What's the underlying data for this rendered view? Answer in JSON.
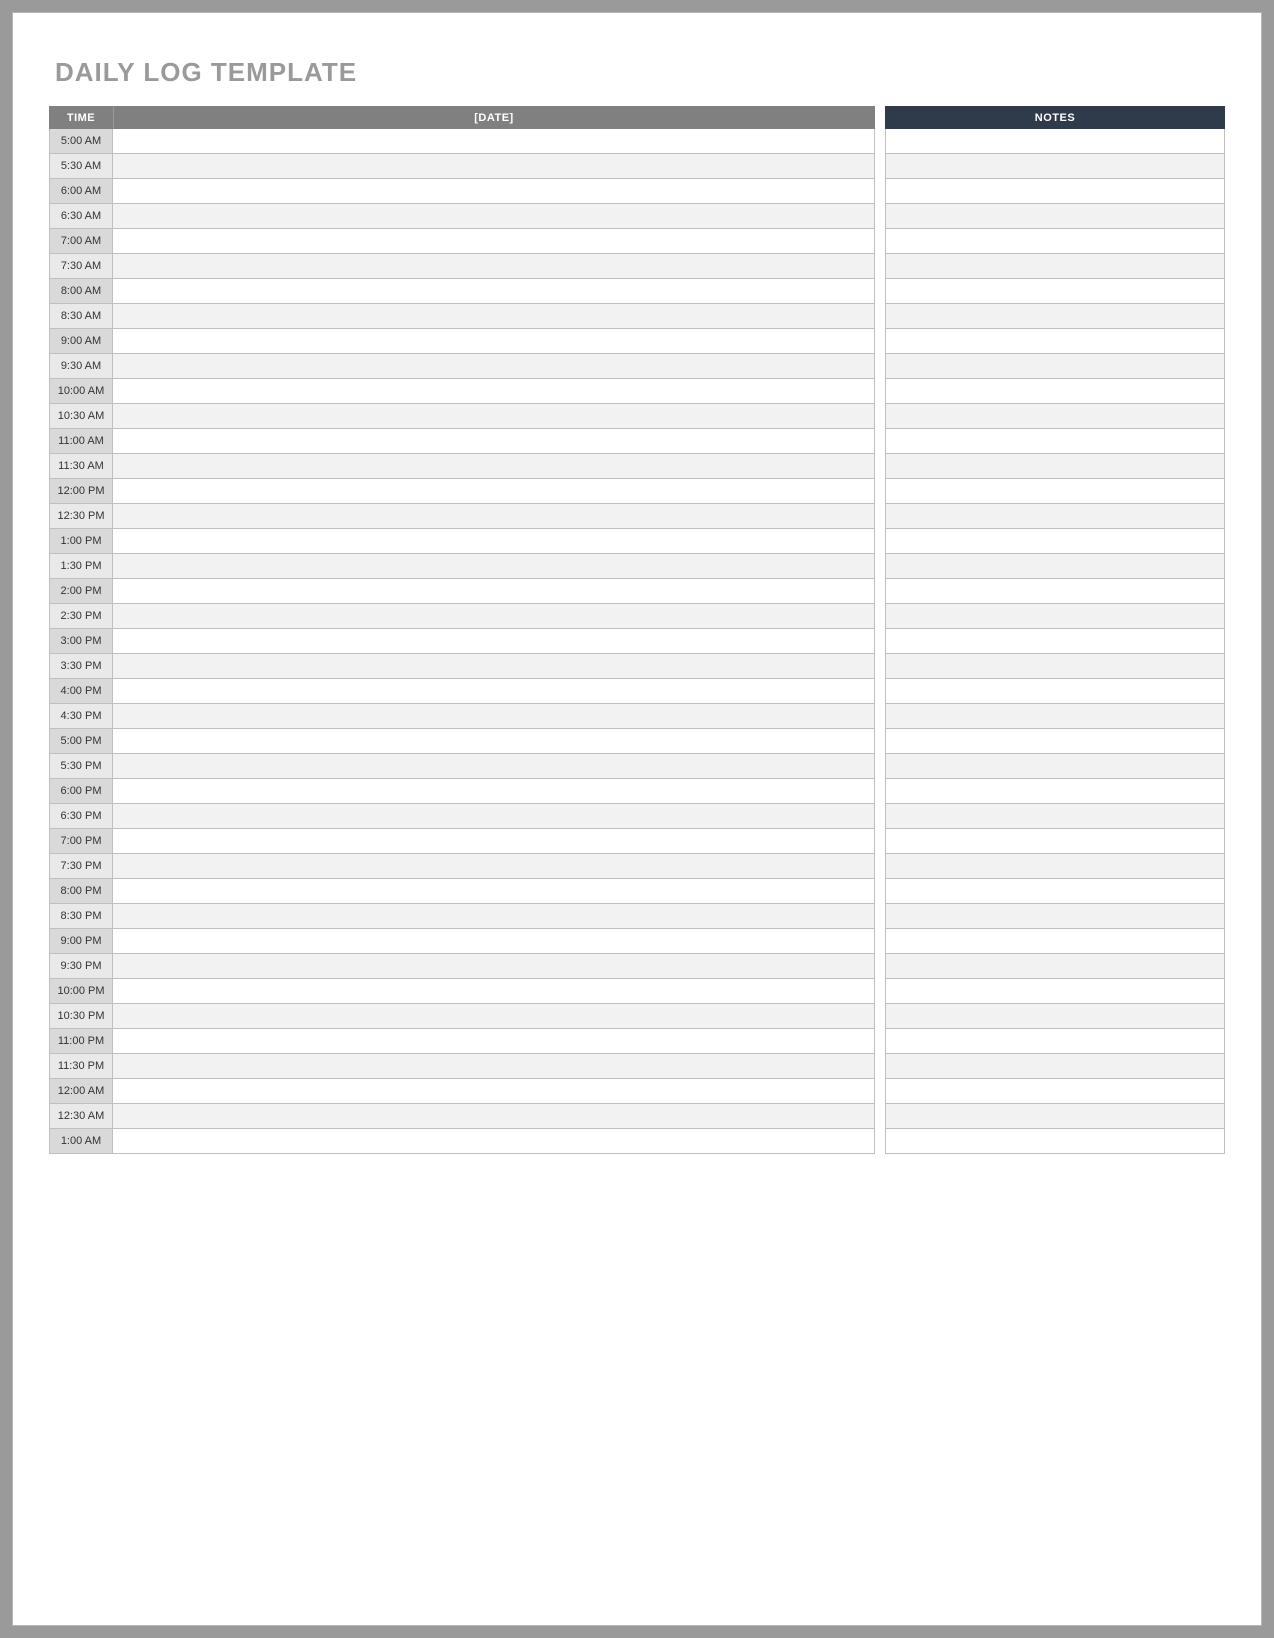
{
  "title": "DAILY LOG TEMPLATE",
  "headers": {
    "time": "TIME",
    "date": "[DATE]",
    "notes": "NOTES"
  },
  "rows": [
    {
      "time": "5:00 AM",
      "entry": "",
      "notes": ""
    },
    {
      "time": "5:30 AM",
      "entry": "",
      "notes": ""
    },
    {
      "time": "6:00 AM",
      "entry": "",
      "notes": ""
    },
    {
      "time": "6:30 AM",
      "entry": "",
      "notes": ""
    },
    {
      "time": "7:00 AM",
      "entry": "",
      "notes": ""
    },
    {
      "time": "7:30 AM",
      "entry": "",
      "notes": ""
    },
    {
      "time": "8:00 AM",
      "entry": "",
      "notes": ""
    },
    {
      "time": "8:30 AM",
      "entry": "",
      "notes": ""
    },
    {
      "time": "9:00 AM",
      "entry": "",
      "notes": ""
    },
    {
      "time": "9:30 AM",
      "entry": "",
      "notes": ""
    },
    {
      "time": "10:00 AM",
      "entry": "",
      "notes": ""
    },
    {
      "time": "10:30 AM",
      "entry": "",
      "notes": ""
    },
    {
      "time": "11:00 AM",
      "entry": "",
      "notes": ""
    },
    {
      "time": "11:30 AM",
      "entry": "",
      "notes": ""
    },
    {
      "time": "12:00 PM",
      "entry": "",
      "notes": ""
    },
    {
      "time": "12:30 PM",
      "entry": "",
      "notes": ""
    },
    {
      "time": "1:00 PM",
      "entry": "",
      "notes": ""
    },
    {
      "time": "1:30 PM",
      "entry": "",
      "notes": ""
    },
    {
      "time": "2:00 PM",
      "entry": "",
      "notes": ""
    },
    {
      "time": "2:30 PM",
      "entry": "",
      "notes": ""
    },
    {
      "time": "3:00 PM",
      "entry": "",
      "notes": ""
    },
    {
      "time": "3:30 PM",
      "entry": "",
      "notes": ""
    },
    {
      "time": "4:00 PM",
      "entry": "",
      "notes": ""
    },
    {
      "time": "4:30 PM",
      "entry": "",
      "notes": ""
    },
    {
      "time": "5:00 PM",
      "entry": "",
      "notes": ""
    },
    {
      "time": "5:30 PM",
      "entry": "",
      "notes": ""
    },
    {
      "time": "6:00 PM",
      "entry": "",
      "notes": ""
    },
    {
      "time": "6:30 PM",
      "entry": "",
      "notes": ""
    },
    {
      "time": "7:00 PM",
      "entry": "",
      "notes": ""
    },
    {
      "time": "7:30 PM",
      "entry": "",
      "notes": ""
    },
    {
      "time": "8:00 PM",
      "entry": "",
      "notes": ""
    },
    {
      "time": "8:30 PM",
      "entry": "",
      "notes": ""
    },
    {
      "time": "9:00 PM",
      "entry": "",
      "notes": ""
    },
    {
      "time": "9:30 PM",
      "entry": "",
      "notes": ""
    },
    {
      "time": "10:00 PM",
      "entry": "",
      "notes": ""
    },
    {
      "time": "10:30 PM",
      "entry": "",
      "notes": ""
    },
    {
      "time": "11:00 PM",
      "entry": "",
      "notes": ""
    },
    {
      "time": "11:30 PM",
      "entry": "",
      "notes": ""
    },
    {
      "time": "12:00 AM",
      "entry": "",
      "notes": ""
    },
    {
      "time": "12:30 AM",
      "entry": "",
      "notes": ""
    },
    {
      "time": "1:00 AM",
      "entry": "",
      "notes": ""
    }
  ]
}
